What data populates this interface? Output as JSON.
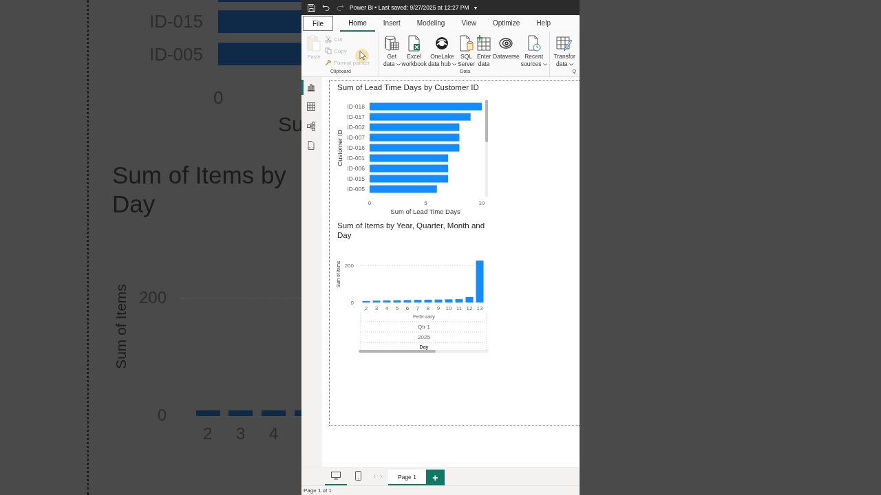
{
  "backdrop": {
    "bar_labels": [
      "ID-015",
      "ID-005"
    ],
    "x_tick": "0",
    "x_title_part": "Su",
    "chart_title_lines": [
      "Sum of Items by",
      "Day"
    ],
    "y_title": "Sum of Items",
    "y_ticks": [
      "200",
      "0"
    ],
    "x_ticks": [
      "2",
      "3",
      "4"
    ]
  },
  "window": {
    "title": "Power Bi • Last saved: 9/27/2025 at 12:27 PM",
    "menu_caret": "▼"
  },
  "menu_tabs": [
    {
      "label": "File",
      "kind": "file",
      "selected": false
    },
    {
      "label": "Home",
      "kind": "tab",
      "selected": true
    },
    {
      "label": "Insert",
      "kind": "tab",
      "selected": false
    },
    {
      "label": "Modeling",
      "kind": "tab",
      "selected": false
    },
    {
      "label": "View",
      "kind": "tab",
      "selected": false
    },
    {
      "label": "Optimize",
      "kind": "tab",
      "selected": false
    },
    {
      "label": "Help",
      "kind": "tab",
      "selected": false
    }
  ],
  "ribbon": {
    "clipboard": {
      "label": "Clipboard",
      "main": {
        "label": "Paste",
        "disabled": true
      },
      "small": [
        {
          "label": "Cut",
          "disabled": true
        },
        {
          "label": "Copy",
          "disabled": true
        },
        {
          "label": "Format painter",
          "disabled": true
        }
      ]
    },
    "data": {
      "label": "Data",
      "buttons": [
        {
          "lines": [
            "Get",
            "data"
          ],
          "dropdown": true
        },
        {
          "lines": [
            "Excel",
            "workbook"
          ],
          "dropdown": false
        },
        {
          "lines": [
            "OneLake",
            "data hub"
          ],
          "dropdown": true
        },
        {
          "lines": [
            "SQL",
            "Server"
          ],
          "dropdown": false
        },
        {
          "lines": [
            "Enter",
            "data"
          ],
          "dropdown": false
        },
        {
          "lines": [
            "Dataverse"
          ],
          "dropdown": false
        },
        {
          "lines": [
            "Recent",
            "sources"
          ],
          "dropdown": true
        }
      ]
    },
    "queries": {
      "label": "Q",
      "buttons": [
        {
          "lines": [
            "Transfor",
            "data"
          ],
          "dropdown": true
        }
      ]
    }
  },
  "rail": [
    {
      "selected": true
    },
    {
      "selected": false
    },
    {
      "selected": false
    },
    {
      "selected": false
    }
  ],
  "visuals": [
    {
      "chart_data": {
        "type": "bar",
        "orientation": "horizontal",
        "title": "Sum of Lead Time Days by Customer ID",
        "xlabel": "Sum of Lead Time Days",
        "ylabel": "Customer ID",
        "categories": [
          "ID-018",
          "ID-017",
          "ID-002",
          "ID-007",
          "ID-016",
          "ID-001",
          "ID-006",
          "ID-015",
          "ID-005"
        ],
        "values": [
          10,
          9,
          8,
          8,
          8,
          7,
          7,
          7,
          6
        ],
        "xlim": [
          0,
          10
        ],
        "xticks": [
          0,
          5,
          10
        ]
      }
    },
    {
      "chart_data": {
        "type": "bar",
        "title": "Sum of Items by Year, Quarter, Month and Day",
        "xlabel": "Day",
        "ylabel": "Sum of Items",
        "categories": [
          "2",
          "3",
          "4",
          "5",
          "6",
          "7",
          "8",
          "9",
          "10",
          "11",
          "12",
          "13"
        ],
        "values": [
          8,
          10,
          11,
          12,
          13,
          14,
          15,
          16,
          17,
          18,
          30,
          226
        ],
        "ylim": [
          0,
          226
        ],
        "yticks": [
          0,
          200
        ]
      },
      "axis_levels": [
        "February",
        "Qtr 1",
        "2025"
      ]
    }
  ],
  "page_bar": {
    "views": [
      {
        "selected": true
      },
      {
        "selected": false
      }
    ],
    "pages": [
      {
        "label": "Page 1",
        "selected": true
      }
    ],
    "add_label": "+"
  },
  "status_bar": "Page 1 of 1"
}
